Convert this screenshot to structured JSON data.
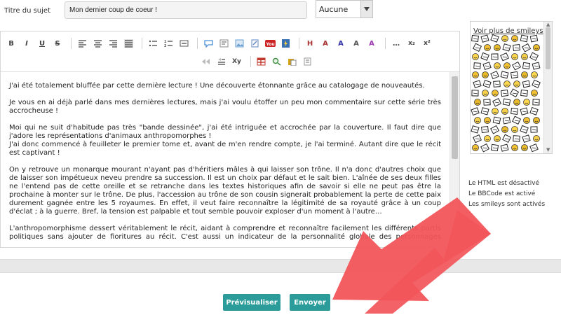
{
  "form": {
    "subject_label": "Titre du sujet",
    "subject_value": "Mon dernier coup de coeur !",
    "icon_select_value": "Aucune"
  },
  "toolbar": {
    "row1": [
      {
        "name": "bold-button",
        "label": "B"
      },
      {
        "name": "italic-button",
        "label": "I"
      },
      {
        "name": "underline-button",
        "label": "U"
      },
      {
        "name": "strike-button",
        "label": "S"
      },
      {
        "sep": true
      },
      {
        "name": "align-left-button",
        "icon": "align-left"
      },
      {
        "name": "align-center-button",
        "icon": "align-center"
      },
      {
        "name": "align-right-button",
        "icon": "align-right"
      },
      {
        "name": "align-justify-button",
        "icon": "align-justify"
      },
      {
        "sep": true
      },
      {
        "name": "bullet-list-button",
        "icon": "list-bullet"
      },
      {
        "name": "numbered-list-button",
        "icon": "list-number"
      },
      {
        "name": "horizontal-rule-button",
        "icon": "hr"
      },
      {
        "sep": true
      },
      {
        "name": "quote-button",
        "icon": "quote",
        "color": "#4a8fd8"
      },
      {
        "name": "code-button",
        "icon": "code",
        "color": "#888888"
      },
      {
        "name": "image-button",
        "icon": "image",
        "color": "#6a9fd0"
      },
      {
        "name": "link-button",
        "icon": "link",
        "color": "#5a86c0"
      },
      {
        "name": "youtube-button",
        "icon": "youtube",
        "color": "#cc2222"
      },
      {
        "name": "flash-button",
        "icon": "flash",
        "color": "#3a6fb0"
      },
      {
        "sep": true
      },
      {
        "name": "heading-button",
        "label": "H",
        "color": "#a33"
      },
      {
        "name": "font-button",
        "label": "A",
        "color": "#a33"
      },
      {
        "name": "color-button",
        "label": "A",
        "color": "#33a"
      },
      {
        "name": "size-button",
        "label": "A",
        "color": "#555"
      },
      {
        "name": "highlight-button",
        "label": "A",
        "color": "#9b3ab0"
      },
      {
        "sep": true
      },
      {
        "name": "more-button",
        "label": "…"
      },
      {
        "name": "subscript-button",
        "label": "x₂"
      },
      {
        "name": "superscript-button",
        "label": "x²"
      }
    ],
    "row2": [
      {
        "name": "outdent-button",
        "icon": "outdent"
      },
      {
        "name": "indent-button",
        "icon": "indent"
      },
      {
        "name": "remove-format-button",
        "label": "Xy"
      },
      {
        "sep": true
      },
      {
        "name": "table-button",
        "icon": "table",
        "color": "#c0392b"
      },
      {
        "name": "search-button",
        "icon": "search",
        "color": "#3e8e41"
      },
      {
        "name": "paste-button",
        "icon": "paste",
        "color": "#d4a017"
      },
      {
        "name": "source-button",
        "icon": "source",
        "color": "#999999"
      }
    ]
  },
  "body_paragraphs": [
    "J'ai été totalement bluffée par cette dernière lecture ! Une découverte étonnante grâce au catalogage de nouveautés.",
    "Je vous en ai déjà parlé dans mes dernières lectures, mais j'ai voulu étoffer un peu mon commentaire sur cette série très accrocheuse !",
    "Moi qui ne suit d'habitude pas très \"bande dessinée\", j'ai été intriguée et accrochée par la couverture. Il faut dire que j'adore les représentations d'animaux anthropomorphes !\nJ'ai donc commencé à feuilleter le premier tome et, avant de m'en rendre compte, je l'ai terminé. Autant dire que le récit est captivant !",
    "On y retrouve un monarque mourant n'ayant pas d'héritiers mâles à qui laisser son trône. Il n'a donc d'autres choix que de laisser son impétueux neveu prendre sa succession. Il est un choix par défaut et le sait bien. L'aînée de ses deux filles ne l'entend pas de cette oreille et se retranche dans les textes historiques afin de savoir si elle ne peut pas être la prochaine à monter sur le trône. De plus, l'accession au trône de son cousin signerait probablement la perte de cette paix durement gagnée entre les 5 royaumes. En effet, il veut faire reconnaître la légitimité de sa royauté grâce à un coup d'éclat ; à la guerre. Bref, la tension est palpable et tout semble pouvoir exploser d'un moment à l'autre…",
    "L'anthropomorphisme dessert véritablement le récit, aidant à comprendre et reconnaître facilement les différents partis politiques sans ajouter de fioritures au récit. C'est aussi un indicateur de la personnalité globale des personnages rencontrés, à la manière de Blacksad on se rend rapidement compte si on a affaire à un fieffé renard ou à"
  ],
  "smileys": {
    "title": "Voir plus de smileys"
  },
  "info": {
    "html": "Le HTML est désactivé",
    "bbcode": "Le BBCode est activé",
    "smileys": "Les smileys sont activés"
  },
  "buttons": {
    "preview": "Prévisualiser",
    "submit": "Envoyer"
  },
  "colors": {
    "button": "#2c9c9b",
    "arrow": "#f2555a"
  }
}
